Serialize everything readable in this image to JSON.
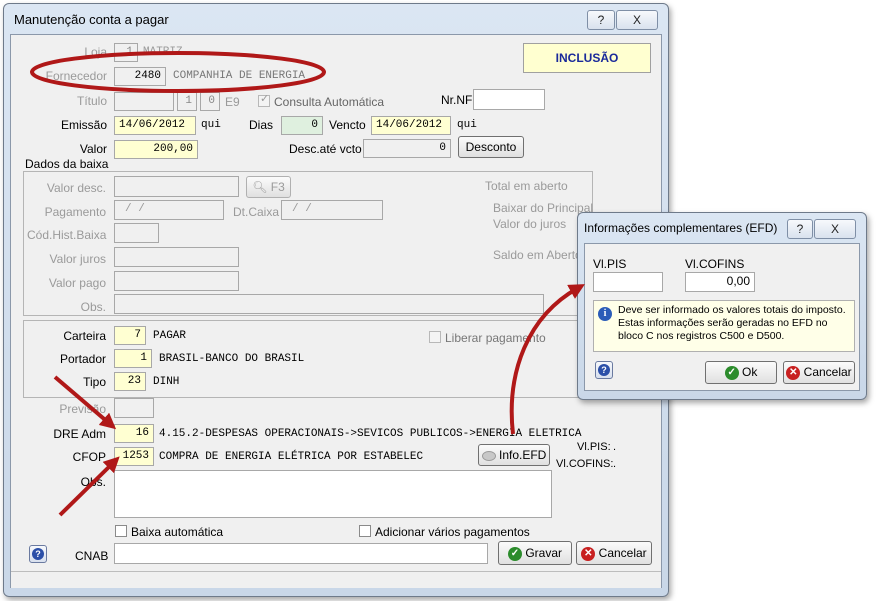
{
  "main_window": {
    "title": "Manutenção conta a pagar",
    "help_button": "?",
    "close_button": "X",
    "mode": "INCLUSÃO",
    "loja": {
      "label": "Loja",
      "value": "1",
      "name": "MATRIZ"
    },
    "fornecedor": {
      "label": "Fornecedor",
      "code": "2480",
      "name": "COMPANHIA DE ENERGIA"
    },
    "titulo": {
      "label": "Título",
      "parcela": "1",
      "sub": "0",
      "tipo": "E9"
    },
    "consulta_automatica": "Consulta Automática",
    "nr_nf": {
      "label": "Nr.NF",
      "value": ""
    },
    "emissao": {
      "label": "Emissão",
      "value": "14/06/2012",
      "weekday": "qui"
    },
    "dias": {
      "label": "Dias",
      "value": "0"
    },
    "vencto": {
      "label": "Vencto",
      "value": "14/06/2012",
      "weekday": "qui"
    },
    "valor": {
      "label": "Valor",
      "value": "200,00"
    },
    "desc_ate_vcto": {
      "label": "Desc.até vcto",
      "value": "0"
    },
    "desconto_button": "Desconto",
    "dados_baixa": {
      "title": "Dados da baixa",
      "valor_desc": "Valor desc.",
      "f3_button": "F3",
      "pagamento": "Pagamento",
      "pagamento_value": "/   /",
      "dt_caixa": "Dt.Caixa",
      "dt_caixa_value": "/   /",
      "cod_hist_baixa": "Cód.Hist.Baixa",
      "valor_juros": "Valor juros",
      "valor_pago": "Valor pago",
      "obs": "Obs.",
      "total_em_aberto": "Total em aberto",
      "baixar_do_principal": "Baixar do Principal",
      "valor_do_juros": "Valor do juros",
      "saldo_em_aberto": "Saldo em Aberto"
    },
    "carteira": {
      "label": "Carteira",
      "code": "7",
      "name": "PAGAR"
    },
    "liberar_pagamento": "Liberar pagamento",
    "portador": {
      "label": "Portador",
      "code": "1",
      "name": "BRASIL-BANCO DO BRASIL"
    },
    "tipo": {
      "label": "Tipo",
      "code": "23",
      "name": "DINH"
    },
    "previsao": {
      "label": "Previsão"
    },
    "dre_adm": {
      "label": "DRE Adm",
      "code": "16",
      "name": "4.15.2-DESPESAS OPERACIONAIS->SEVICOS PUBLICOS->ENERGIA ELETRICA"
    },
    "cfop": {
      "label": "CFOP",
      "code": "1253",
      "name": "COMPRA DE ENERGIA ELÉTRICA POR ESTABELEC"
    },
    "info_efd_button": "Info.EFD",
    "vl_pis_label": "Vl.PIS:",
    "vl_pis_value": ".",
    "vl_cofins_label": "Vl.COFINS:",
    "vl_cofins_value": ".",
    "obs_label": "Obs.",
    "baixa_automatica": "Baixa automática",
    "adicionar_varios_pagamentos": "Adicionar vários pagamentos",
    "cnab": {
      "label": "CNAB",
      "value": ""
    },
    "gravar_button": "Gravar",
    "cancelar_button": "Cancelar"
  },
  "efd_dialog": {
    "title": "Informações complementares (EFD)",
    "help_button": "?",
    "close_button": "X",
    "vl_pis": {
      "label": "Vl.PIS",
      "value": ""
    },
    "vl_cofins": {
      "label": "Vl.COFINS",
      "value": "0,00"
    },
    "info_text": "Deve ser informado os valores totais do imposto. Estas informações serão geradas no EFD no bloco C nos registros C500 e D500.",
    "ok_button": "Ok",
    "cancelar_button": "Cancelar"
  },
  "annotation_color": "#b01818"
}
